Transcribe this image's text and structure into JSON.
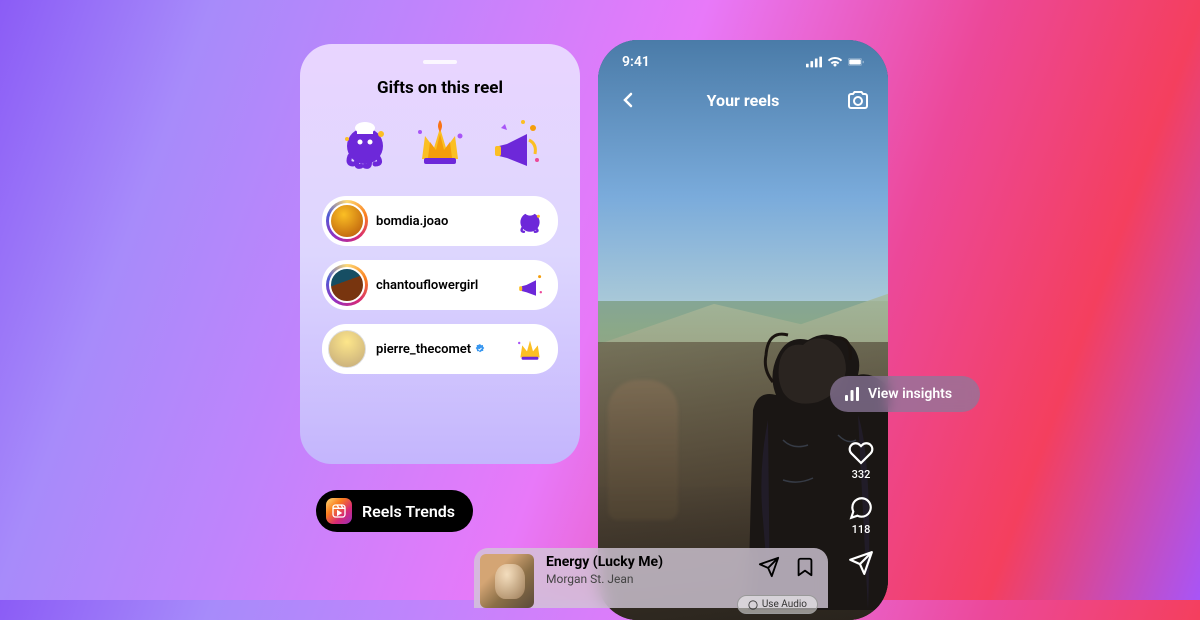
{
  "gifts_card": {
    "title": "Gifts on this reel",
    "gift_types": [
      "octopus-chef",
      "fire-crown",
      "megaphone-confetti"
    ],
    "gifters": [
      {
        "username": "bomdia.joao",
        "verified": false,
        "avatar_style": "av1",
        "gift": "octopus-chef"
      },
      {
        "username": "chantouflowergirl",
        "verified": false,
        "avatar_style": "av2",
        "gift": "megaphone-confetti"
      },
      {
        "username": "pierre_thecomet",
        "verified": true,
        "avatar_style": "av3",
        "gift": "fire-crown"
      }
    ]
  },
  "reels_trends": {
    "label": "Reels Trends"
  },
  "phone": {
    "status_time": "9:41",
    "header_title": "Your reels",
    "insights_label": "View insights",
    "actions": {
      "likes": "332",
      "comments": "118"
    }
  },
  "audio_card": {
    "title": "Energy (Lucky Me)",
    "artist": "Morgan St. Jean",
    "use_audio_label": "Use Audio"
  }
}
